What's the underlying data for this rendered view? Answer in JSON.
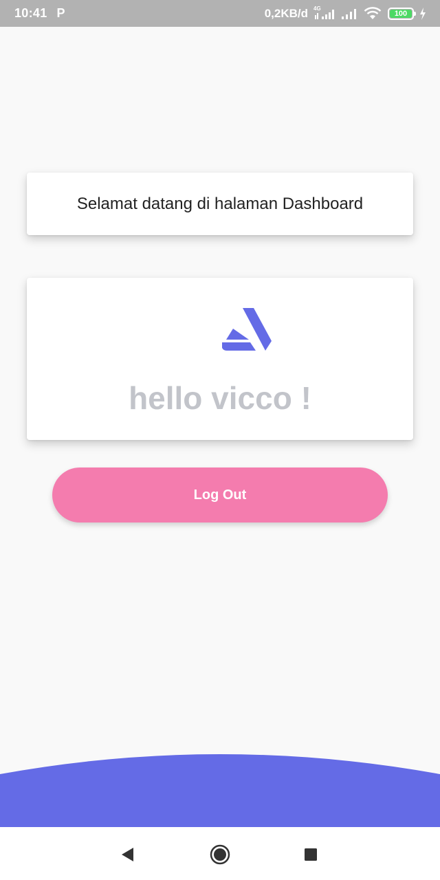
{
  "status_bar": {
    "time": "10:41",
    "app_indicator": "P",
    "data_speed": "0,2KB/d",
    "network_type": "4G",
    "battery_level": "100"
  },
  "welcome_card": {
    "text": "Selamat datang di halaman Dashboard"
  },
  "hello_card": {
    "logo_icon": "artstation-logo-icon",
    "greeting": "hello vicco !"
  },
  "logout_button": {
    "label": "Log Out"
  },
  "nav_bar": {
    "back": "back-icon",
    "home": "home-icon",
    "recents": "recents-icon"
  },
  "colors": {
    "status_bar_bg": "#b2b2b2",
    "page_bg": "#f9f9f9",
    "accent_blue": "#646be6",
    "logout_pink": "#f47cae",
    "greeting_gray": "#c2c4ca",
    "battery_green": "#4cd964"
  }
}
